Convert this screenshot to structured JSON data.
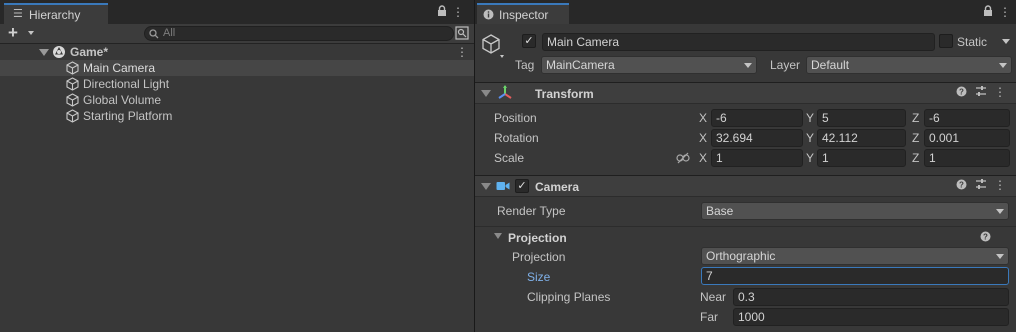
{
  "hierarchy": {
    "tab_label": "Hierarchy",
    "search_placeholder": "All",
    "scene_name": "Game*",
    "items": [
      "Main Camera",
      "Directional Light",
      "Global Volume",
      "Starting Platform"
    ]
  },
  "inspector": {
    "tab_label": "Inspector",
    "object_name": "Main Camera",
    "static_label": "Static",
    "tag_label": "Tag",
    "tag_value": "MainCamera",
    "layer_label": "Layer",
    "layer_value": "Default",
    "transform": {
      "title": "Transform",
      "position_label": "Position",
      "rotation_label": "Rotation",
      "scale_label": "Scale",
      "axis_x": "X",
      "axis_y": "Y",
      "axis_z": "Z",
      "position": {
        "x": "-6",
        "y": "5",
        "z": "-6"
      },
      "rotation": {
        "x": "32.694",
        "y": "42.112",
        "z": "0.001"
      },
      "scale": {
        "x": "1",
        "y": "1",
        "z": "1"
      }
    },
    "camera": {
      "title": "Camera",
      "render_type_label": "Render Type",
      "render_type_value": "Base",
      "projection_section": "Projection",
      "projection_label": "Projection",
      "projection_value": "Orthographic",
      "size_label": "Size",
      "size_value": "7",
      "clipping_label": "Clipping Planes",
      "near_label": "Near",
      "near_value": "0.3",
      "far_label": "Far",
      "far_value": "1000"
    }
  },
  "colors": {
    "accent": "#3a79bb",
    "size_label": "#7fb0e8",
    "panel": "#383838"
  },
  "icons": {
    "hierarchy_tab": "list-icon",
    "inspector_tab": "info-icon",
    "lock": "lock-icon",
    "more": "kebab-menu-icon",
    "add": "plus-icon",
    "search": "search-icon",
    "scene": "unity-scene-icon",
    "gameobject": "cube-icon",
    "transform": "transform-axes-icon",
    "camera": "video-camera-icon",
    "help": "help-icon",
    "preset": "sliders-icon",
    "link": "link-icon"
  }
}
